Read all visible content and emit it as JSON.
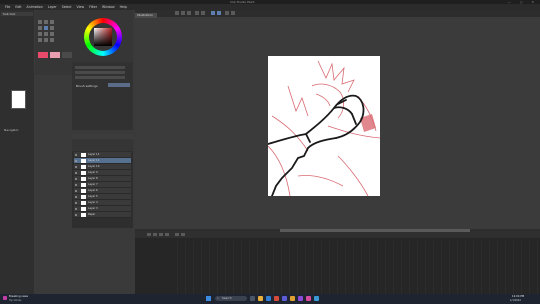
{
  "window": {
    "title": "Clip Studio Paint",
    "controls": "— ▢ ✕"
  },
  "menu": [
    "File",
    "Edit",
    "Animation",
    "Layer",
    "Select",
    "View",
    "Filter",
    "Window",
    "Help"
  ],
  "canvas": {
    "tab_label": "Illustration"
  },
  "navigator": {
    "label": "Navigator"
  },
  "panels": {
    "left_header": "Sub tool",
    "property_label": "Brush settings"
  },
  "layers": [
    {
      "name": "Layer 12"
    },
    {
      "name": "Layer 11"
    },
    {
      "name": "Layer 10"
    },
    {
      "name": "Layer 9"
    },
    {
      "name": "Layer 8"
    },
    {
      "name": "Layer 7"
    },
    {
      "name": "Layer 6"
    },
    {
      "name": "Layer 5"
    },
    {
      "name": "Layer 4"
    },
    {
      "name": "Layer 3"
    },
    {
      "name": "Paper"
    }
  ],
  "colors": {
    "main": "#e84a6b",
    "sub": "#e8a0b0",
    "accent": "#56708f"
  },
  "taskbar": {
    "notification_title": "Breaking news",
    "notification_sub": "Top stories",
    "search_placeholder": "Search",
    "time": "12:04 PM",
    "date": "1/1/2024"
  }
}
